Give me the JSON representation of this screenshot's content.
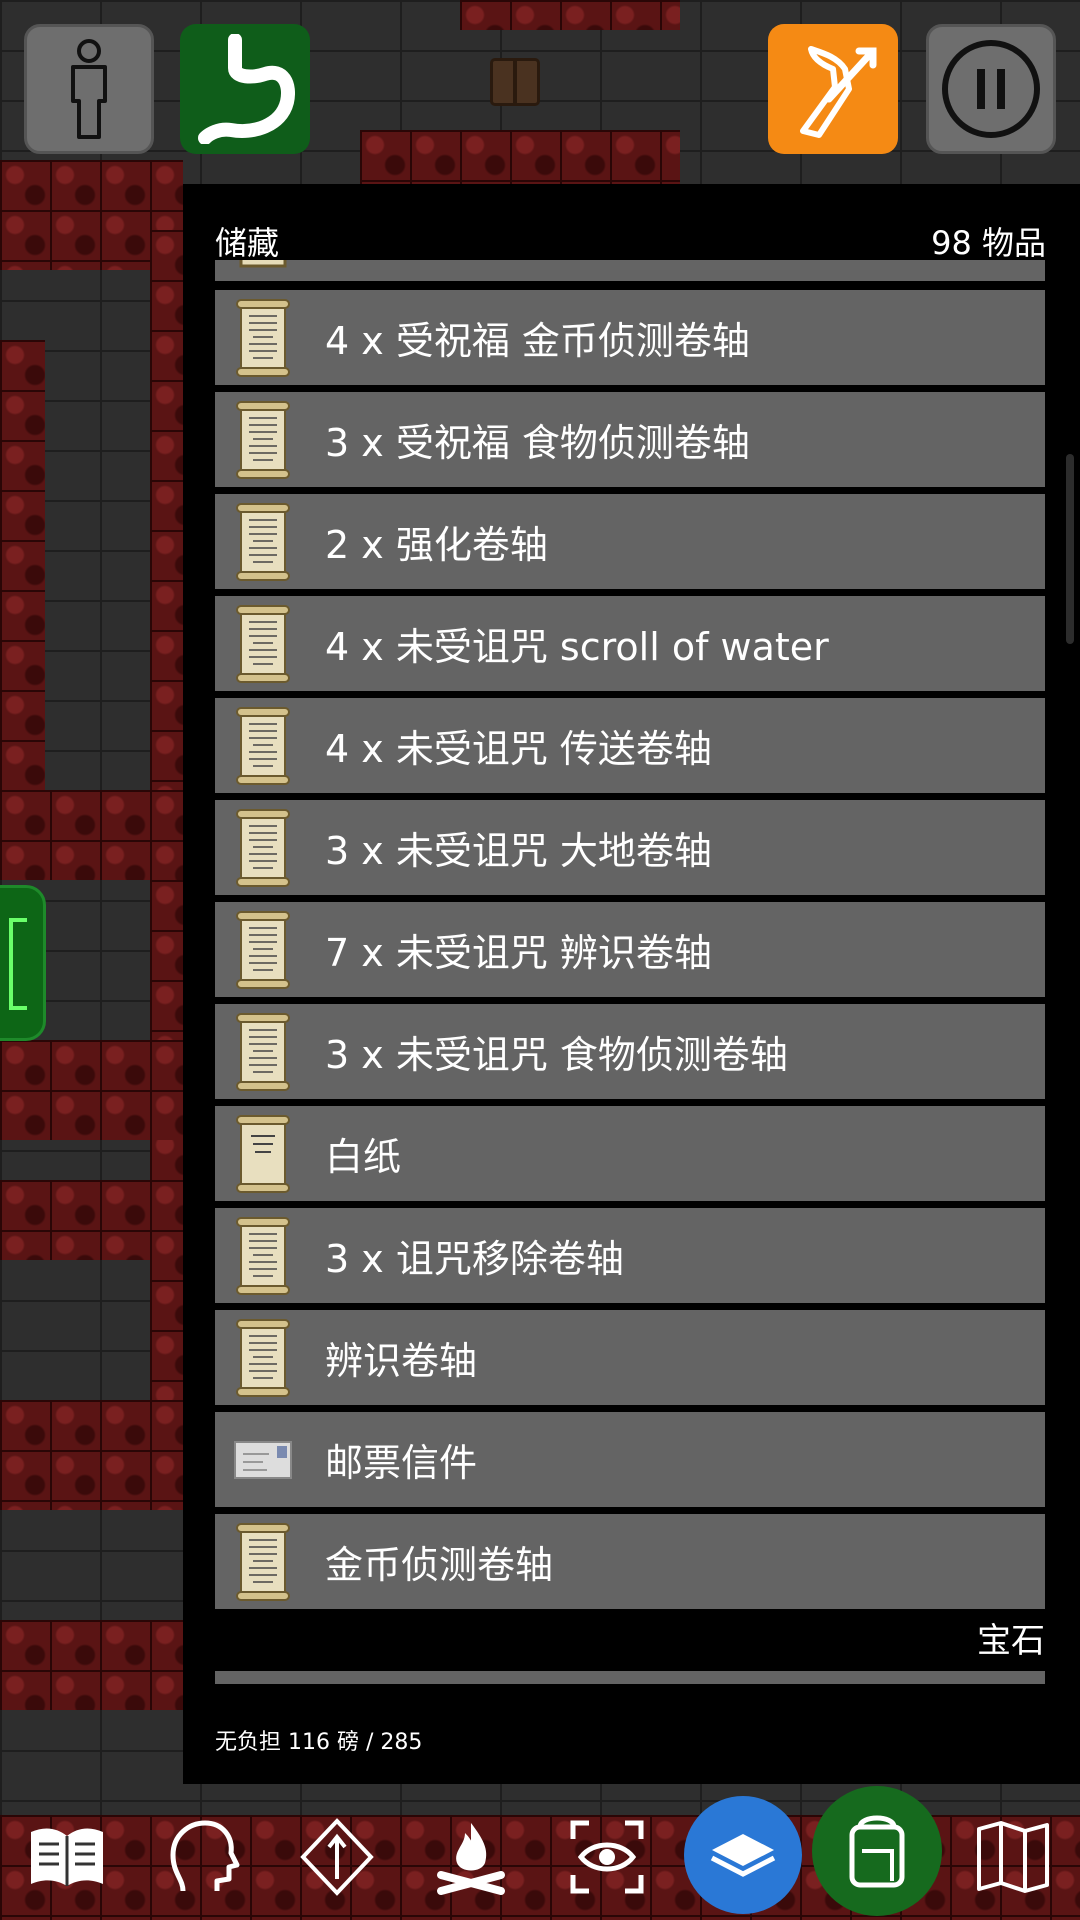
{
  "top_bar": {
    "buttons": [
      {
        "name": "character-button",
        "icon": "person-icon",
        "color": "#6e6e6e"
      },
      {
        "name": "hunger-button",
        "icon": "stomach-icon",
        "color": "#0f5d1a"
      },
      {
        "name": "ranged-attack-button",
        "icon": "arm-arrow-icon",
        "color": "#f58a14"
      },
      {
        "name": "pause-button",
        "icon": "pause-icon",
        "color": "#6e6e6e"
      }
    ]
  },
  "stash": {
    "title": "储藏",
    "count": "98 物品",
    "items": [
      {
        "label": "4 x 受祝福 金币侦测卷轴",
        "icon": "scroll-icon"
      },
      {
        "label": "3 x 受祝福 食物侦测卷轴",
        "icon": "scroll-icon"
      },
      {
        "label": "2 x 强化卷轴",
        "icon": "scroll-icon"
      },
      {
        "label": "4 x 未受诅咒 scroll of water",
        "icon": "scroll-icon"
      },
      {
        "label": "4 x 未受诅咒 传送卷轴",
        "icon": "scroll-icon"
      },
      {
        "label": "3 x 未受诅咒 大地卷轴",
        "icon": "scroll-icon"
      },
      {
        "label": "7 x 未受诅咒 辨识卷轴",
        "icon": "scroll-icon"
      },
      {
        "label": "3 x 未受诅咒 食物侦测卷轴",
        "icon": "scroll-icon"
      },
      {
        "label": "白纸",
        "icon": "blank-scroll-icon"
      },
      {
        "label": "3 x 诅咒移除卷轴",
        "icon": "scroll-icon"
      },
      {
        "label": "辨识卷轴",
        "icon": "scroll-icon"
      },
      {
        "label": "邮票信件",
        "icon": "envelope-icon"
      },
      {
        "label": "金币侦测卷轴",
        "icon": "scroll-icon"
      }
    ],
    "next_section": "宝石",
    "weight": "无负担 116 磅 / 285"
  },
  "bottom_bar": {
    "icons": [
      "book-icon",
      "head-icon",
      "skill-icon",
      "campfire-icon",
      "look-icon",
      "stash-layers-icon",
      "backpack-icon",
      "map-icon"
    ]
  },
  "colors": {
    "row_bg": "#646464",
    "panel_bg": "#000000",
    "accent_blue": "#2a78d6",
    "accent_green": "#166a1e"
  }
}
